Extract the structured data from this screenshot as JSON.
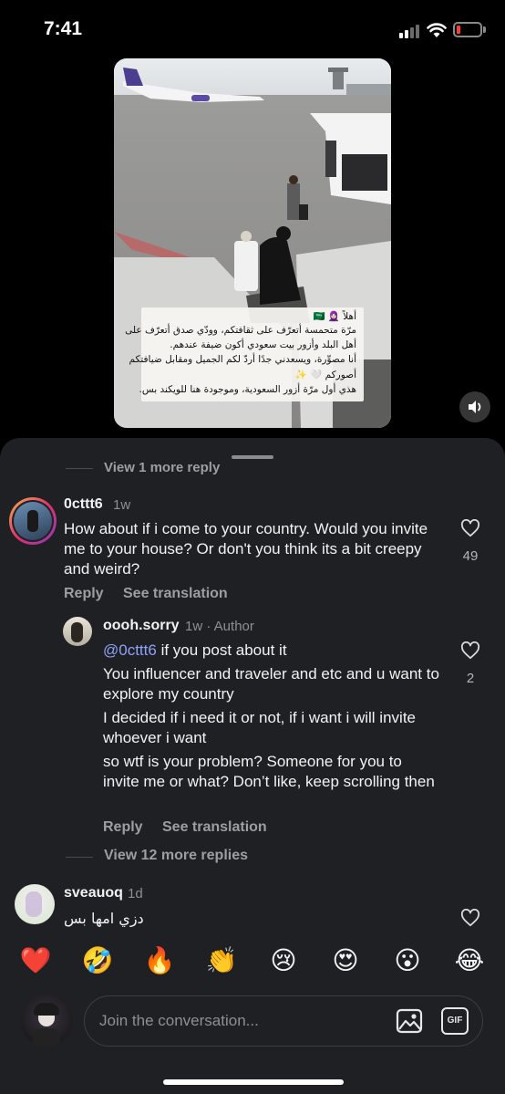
{
  "status_bar": {
    "time": "7:41",
    "battery_color": "#ff3b30"
  },
  "video": {
    "caption_lines": [
      "أهلاً 🧕🏻 🇸🇦",
      "مرّة متحمسة أتعرّف على ثقافتكم، وودّي صدق أتعرّف على",
      "أهل البلد وأزور بيت سعودي أكون ضيفة عندهم.",
      "أنا مصوِّرة، ويسعدني جدًا أردّ لكم الجميل ومقابل ضيافتكم",
      "أصوركم 🤍 ✨",
      "هذي أول مرّة أزور السعودية، وموجودة هنا للويكند بس."
    ],
    "mute_icon": "speaker-icon"
  },
  "thread": {
    "view_more_top": "View 1 more reply",
    "comment1": {
      "username": "0cttt6",
      "time": "1w",
      "text": "How about if i come to your country. Would you invite me to your house? Or don't you think its a bit creepy and weird?",
      "likes": "49",
      "reply_label": "Reply",
      "translate_label": "See translation"
    },
    "reply1": {
      "username": "oooh.sorry",
      "meta": "1w · Author",
      "mention": "@0cttt6",
      "line1": " if you post about it",
      "para2": "You influencer and traveler and etc and u want to explore my country",
      "para3": "I decided if i need it or not, if i want i will invite whoever i want",
      "para4": "so wtf is your problem? Someone for you to invite me or what? Don’t like, keep scrolling then",
      "likes": "2",
      "reply_label": "Reply",
      "translate_label": "See translation"
    },
    "view_more_replies": "View 12 more replies",
    "comment2": {
      "username": "sveauoq",
      "time": "1d",
      "text": "دزي امها بس"
    }
  },
  "emoji_bar": [
    "❤️",
    "🤣",
    "🔥",
    "👏",
    "😢",
    "😍",
    "😮",
    "😂"
  ],
  "composer": {
    "placeholder": "Join the conversation...",
    "gif_label": "GIF"
  },
  "colors": {
    "sheet_bg": "#1f2024",
    "mention": "#8ea2f8",
    "heart": "#e8283e"
  }
}
